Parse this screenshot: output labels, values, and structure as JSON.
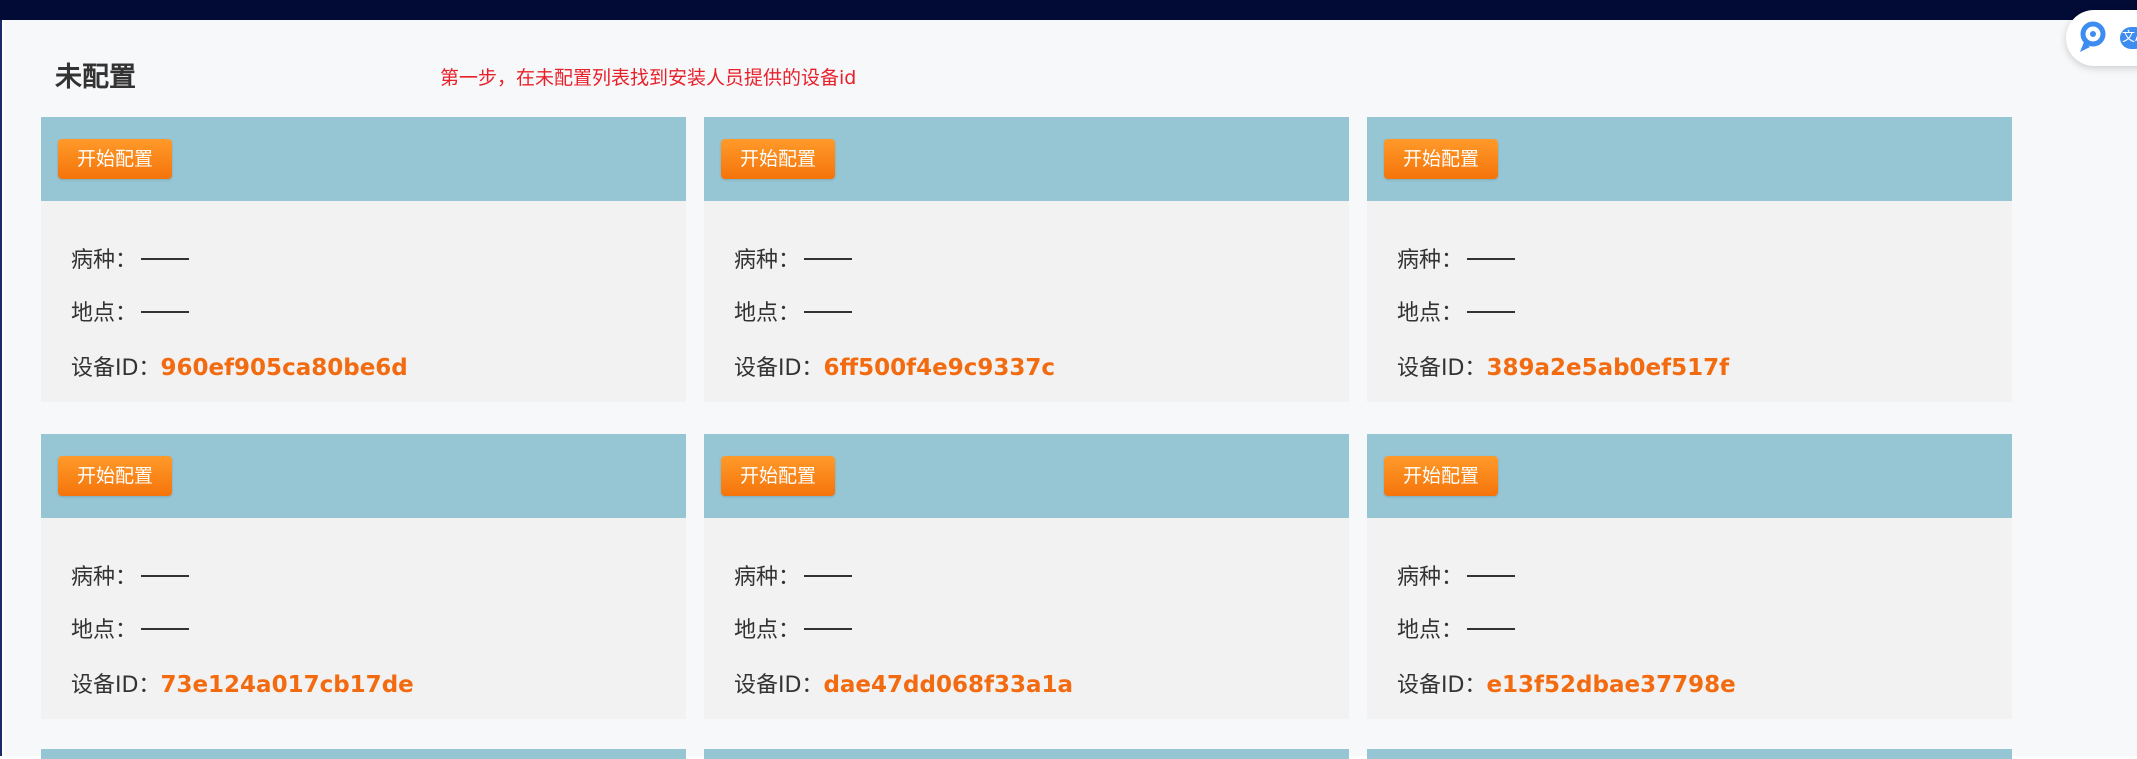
{
  "section": {
    "title": "未配置",
    "hint": "第一步，在未配置列表找到安装人员提供的设备id"
  },
  "labels": {
    "start_button": "开始配置",
    "disease": "病种：",
    "location": "地点：",
    "device_id": "设备ID："
  },
  "cards": [
    {
      "device_id": "960ef905ca80be6d"
    },
    {
      "device_id": "6ff500f4e9c9337c"
    },
    {
      "device_id": "389a2e5ab0ef517f"
    },
    {
      "device_id": "73e124a017cb17de"
    },
    {
      "device_id": "dae47dd068f33a1a"
    },
    {
      "device_id": "e13f52dbae37798e"
    }
  ],
  "widget": {
    "icon": "assistant-logo-icon",
    "badge_icon": "translate-icon",
    "badge_text": "文A"
  },
  "colors": {
    "top_bar": "#020a36",
    "card_header": "#96c5d4",
    "button": "#f5740a",
    "device_id": "#f26b10",
    "hint": "#e8202a"
  }
}
